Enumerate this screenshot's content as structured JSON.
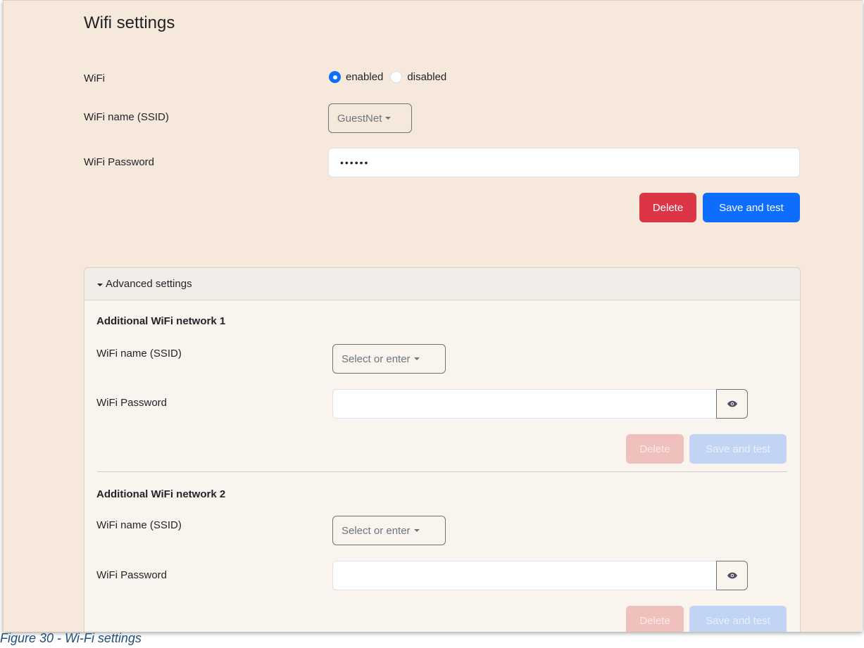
{
  "page": {
    "title": "Wifi settings",
    "wifi_label": "WiFi",
    "radio_enabled": "enabled",
    "radio_disabled": "disabled",
    "ssid_label": "WiFi name (SSID)",
    "ssid_value": "GuestNet",
    "password_label": "WiFi Password",
    "password_value": "••••••",
    "delete_label": "Delete",
    "save_label": "Save and test"
  },
  "advanced": {
    "header": "Advanced settings",
    "networks": [
      {
        "title": "Additional WiFi network 1",
        "ssid_label": "WiFi name (SSID)",
        "ssid_placeholder": "Select or enter",
        "password_label": "WiFi Password",
        "delete_label": "Delete",
        "save_label": "Save and test"
      },
      {
        "title": "Additional WiFi network 2",
        "ssid_label": "WiFi name (SSID)",
        "ssid_placeholder": "Select or enter",
        "password_label": "WiFi Password",
        "delete_label": "Delete",
        "save_label": "Save and test"
      }
    ]
  },
  "caption": "Figure 30 - Wi-Fi settings",
  "colors": {
    "primary": "#0d6efd",
    "danger": "#dc3545",
    "background": "#f7e8dc"
  }
}
